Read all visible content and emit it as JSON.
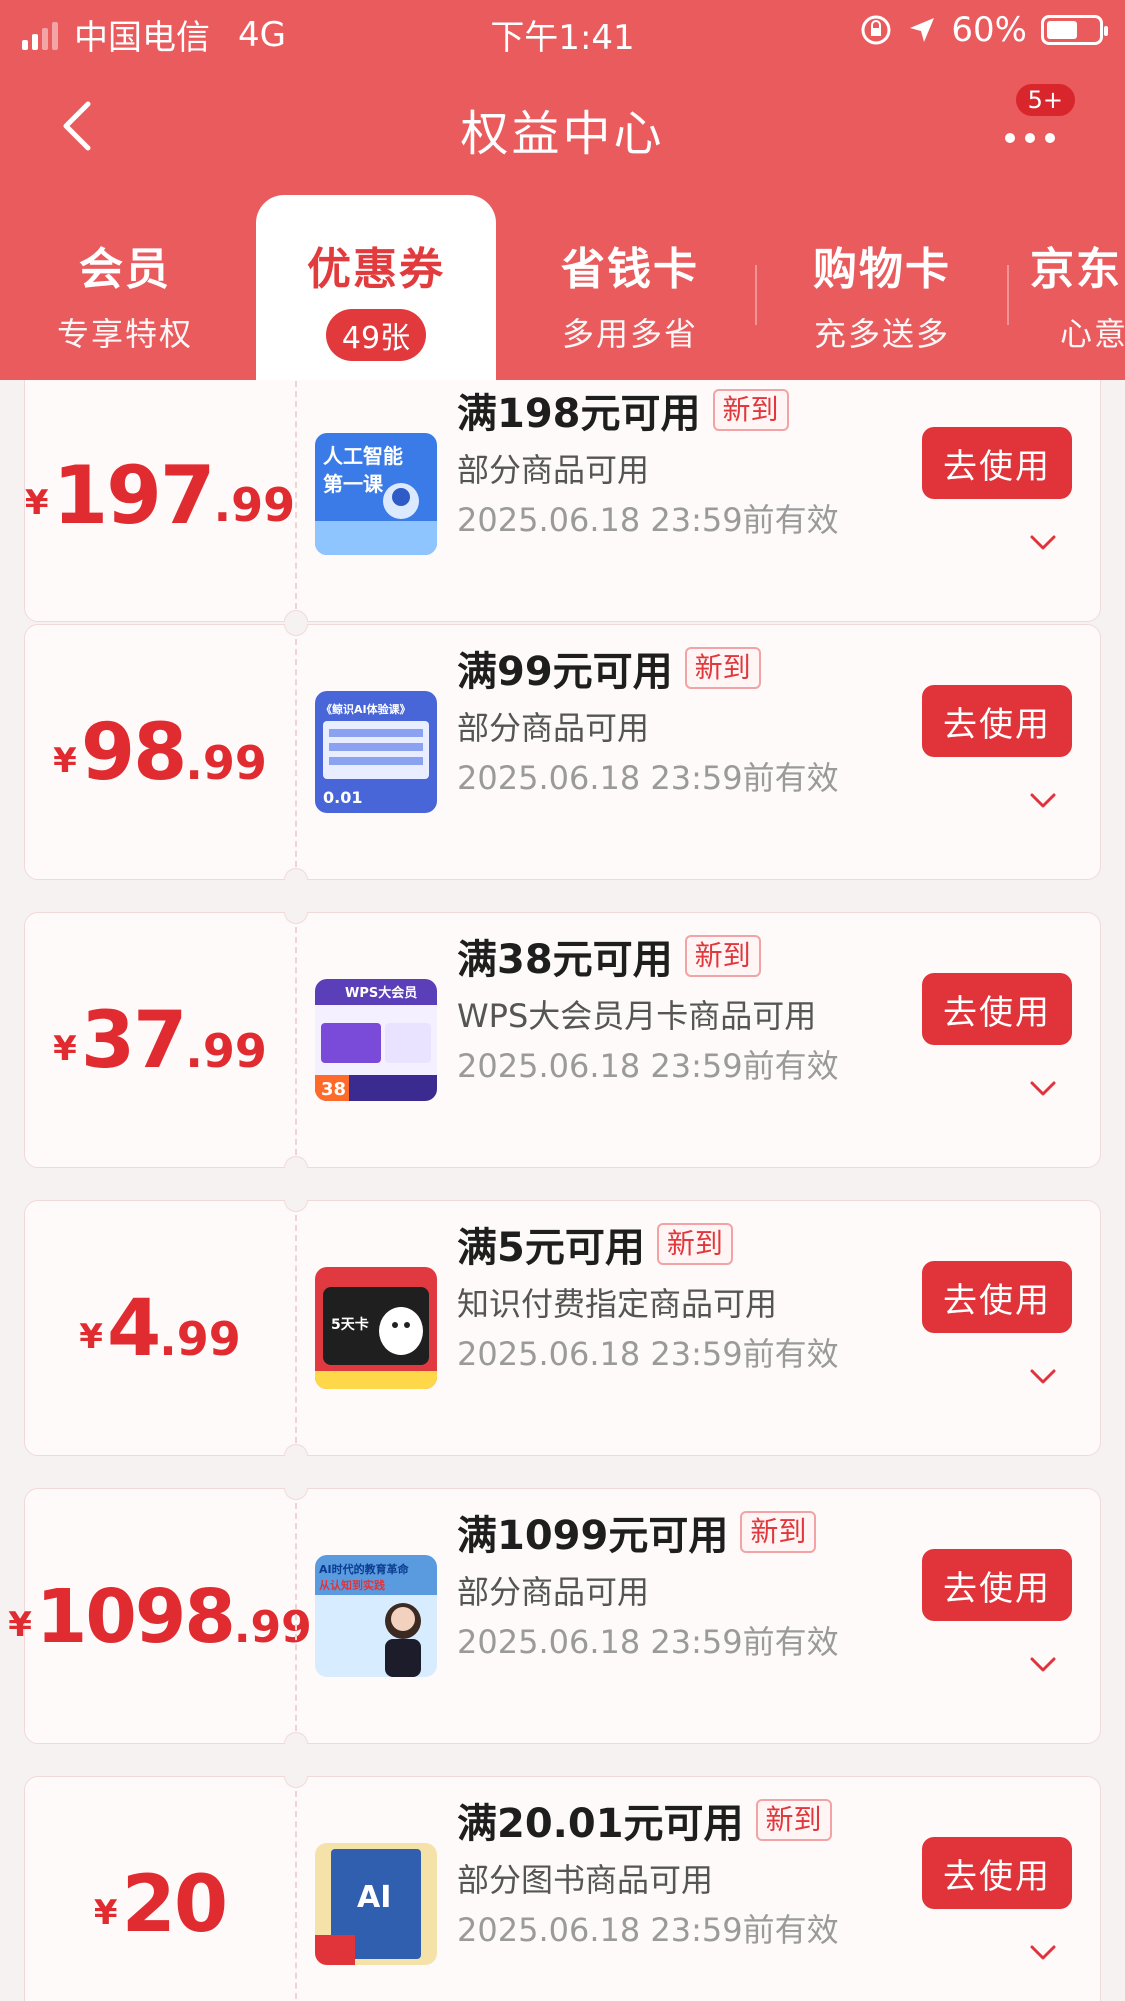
{
  "status_bar": {
    "carrier": "中国电信",
    "network": "4G",
    "time": "下午1:41",
    "battery": "60%",
    "battery_level": 0.6
  },
  "header": {
    "title": "权益中心",
    "more_badge": "5+"
  },
  "tabs": [
    {
      "label": "会员",
      "sub": "专享特权"
    },
    {
      "label": "优惠券",
      "sub": "49张"
    },
    {
      "label": "省钱卡",
      "sub": "多用多省"
    },
    {
      "label": "购物卡",
      "sub": "充多送多"
    },
    {
      "label": "京东",
      "sub": "心意"
    }
  ],
  "coupons": [
    {
      "currency": "¥",
      "int": "197",
      "dec": ".99",
      "condition": "满198元可用",
      "tag": "新到",
      "scope": "部分商品可用",
      "expire": "2025.06.18 23:59前有效",
      "button": "去使用"
    },
    {
      "currency": "¥",
      "int": "98",
      "dec": ".99",
      "condition": "满99元可用",
      "tag": "新到",
      "scope": "部分商品可用",
      "expire": "2025.06.18 23:59前有效",
      "button": "去使用"
    },
    {
      "currency": "¥",
      "int": "37",
      "dec": ".99",
      "condition": "满38元可用",
      "tag": "新到",
      "scope": "WPS大会员月卡商品可用",
      "expire": "2025.06.18 23:59前有效",
      "button": "去使用"
    },
    {
      "currency": "¥",
      "int": "4",
      "dec": ".99",
      "condition": "满5元可用",
      "tag": "新到",
      "scope": "知识付费指定商品可用",
      "expire": "2025.06.18 23:59前有效",
      "button": "去使用"
    },
    {
      "currency": "¥",
      "int": "1098",
      "dec": ".99",
      "condition": "满1099元可用",
      "tag": "新到",
      "scope": "部分商品可用",
      "expire": "2025.06.18 23:59前有效",
      "button": "去使用"
    },
    {
      "currency": "¥",
      "int": "20",
      "dec": "",
      "condition": "满20.01元可用",
      "tag": "新到",
      "scope": "部分图书商品可用",
      "expire": "2025.06.18 23:59前有效",
      "button": "去使用"
    }
  ],
  "thumbnails": [
    {
      "title": "人工智能",
      "sub": "第一课",
      "bg": "#3b7be8"
    },
    {
      "title": "《鲸识AI体验课》",
      "sub": "0.01",
      "bg": "#4966d8"
    },
    {
      "title": "WPS大会员",
      "sub": "38",
      "bg": "#5b3fb8"
    },
    {
      "title": "5天卡",
      "sub": "",
      "bg": "#e03a40"
    },
    {
      "title": "AI时代的教育革命",
      "sub": "从认知到实践",
      "bg": "#5a9be0"
    },
    {
      "title": "AI",
      "sub": "",
      "bg": "#2f5fae"
    }
  ],
  "colors": {
    "brand_red": "#ea5b5e",
    "accent_red": "#e0343a"
  }
}
